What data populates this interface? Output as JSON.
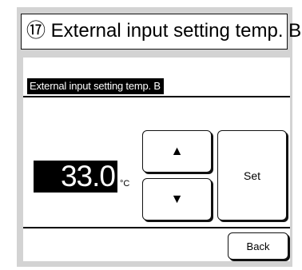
{
  "title": "⑰ External input setting temp. B",
  "screen": {
    "header": "External input setting temp. B",
    "value": "33.0",
    "unit": "°C",
    "up_glyph": "▲",
    "down_glyph": "▼",
    "set_label": "Set",
    "back_label": "Back"
  }
}
